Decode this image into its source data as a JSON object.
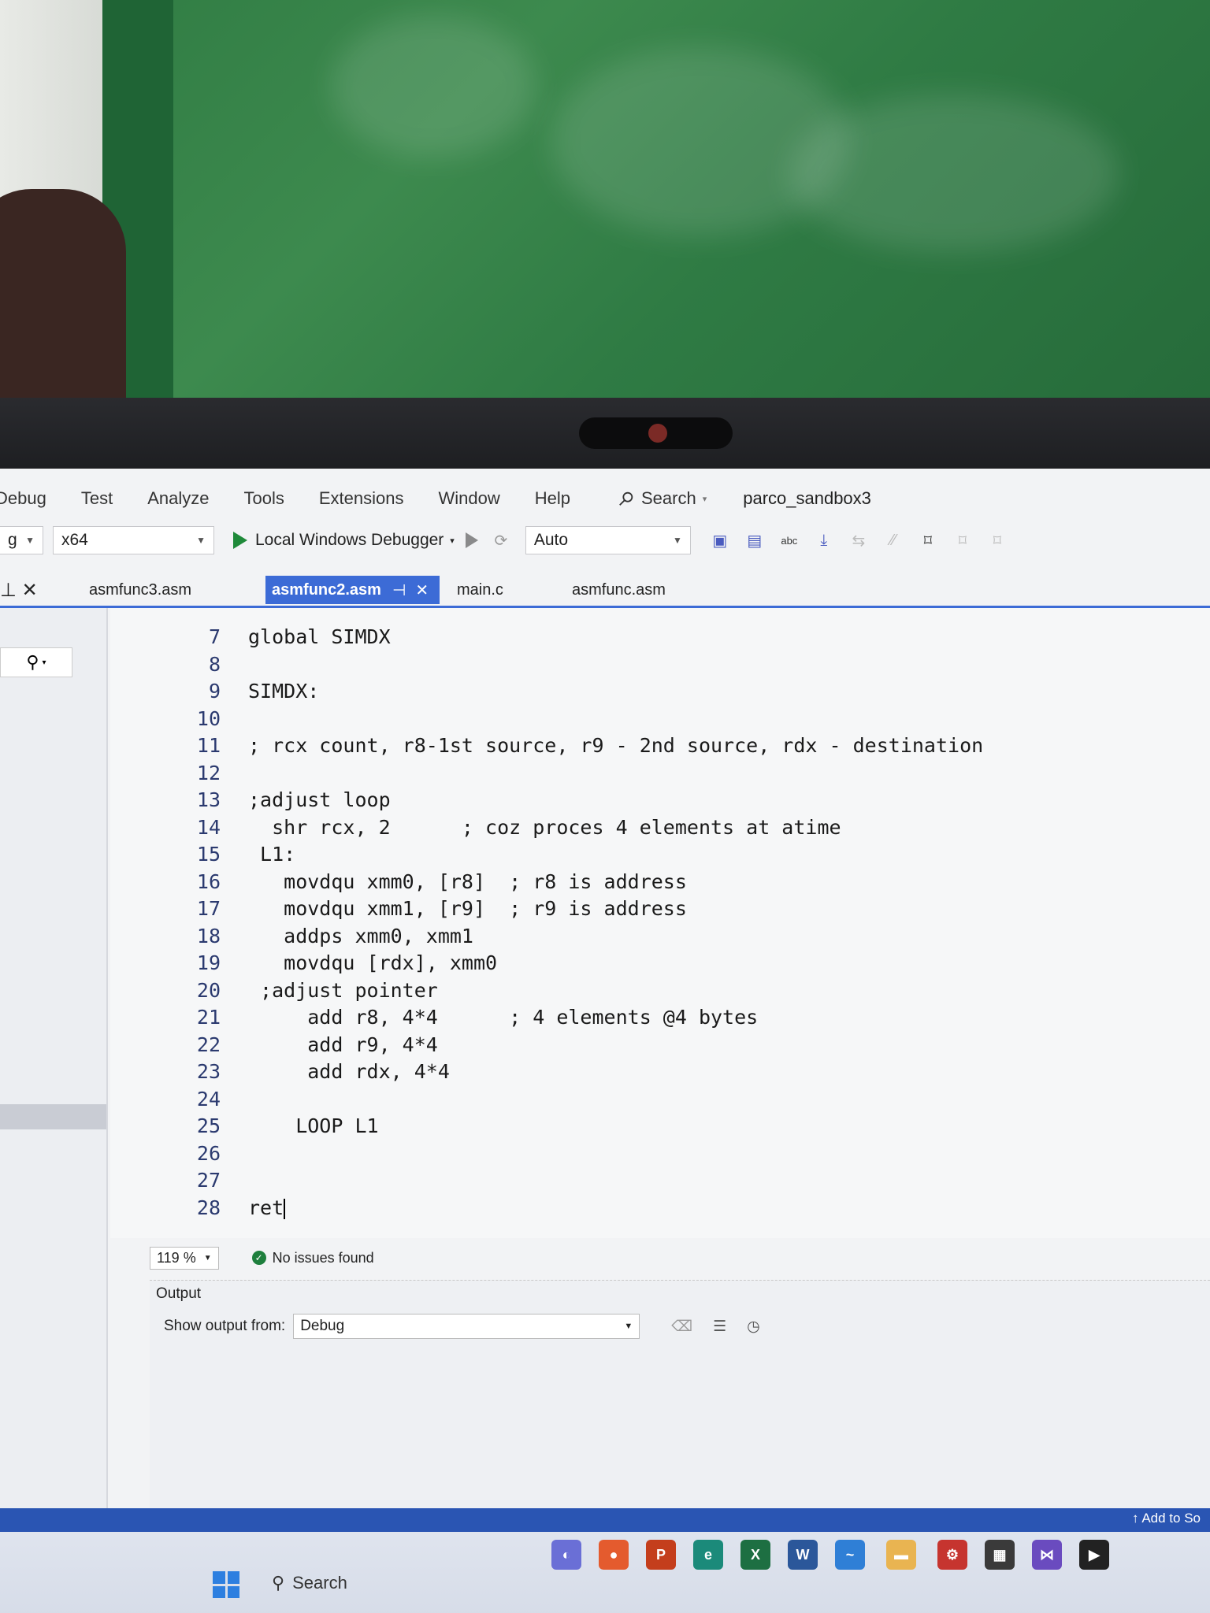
{
  "menubar": {
    "items": [
      "Debug",
      "Test",
      "Analyze",
      "Tools",
      "Extensions",
      "Window",
      "Help"
    ],
    "search_label": "Search",
    "solution_name": "parco_sandbox3"
  },
  "toolbar": {
    "config_value": "g",
    "platform_value": "x64",
    "debugger_label": "Local Windows Debugger",
    "auto_value": "Auto",
    "abc_label": "abc"
  },
  "tabs": {
    "side": "asmfunc3.asm",
    "active": "asmfunc2.asm",
    "tab3": "main.c",
    "tab4": "asmfunc.asm"
  },
  "editor": {
    "line_numbers": [
      "7",
      "8",
      "9",
      "10",
      "11",
      "12",
      "13",
      "14",
      "15",
      "16",
      "17",
      "18",
      "19",
      "20",
      "21",
      "22",
      "23",
      "24",
      "25",
      "26",
      "27",
      "28"
    ],
    "lines": [
      "global SIMDX",
      "",
      "SIMDX:",
      "",
      "; rcx count, r8-1st source, r9 - 2nd source, rdx - destination",
      "",
      ";adjust loop",
      "  shr rcx, 2      ; coz proces 4 elements at atime",
      " L1:",
      "   movdqu xmm0, [r8]  ; r8 is address",
      "   movdqu xmm1, [r9]  ; r9 is address",
      "   addps xmm0, xmm1",
      "   movdqu [rdx], xmm0",
      " ;adjust pointer",
      "     add r8, 4*4      ; 4 elements @4 bytes",
      "     add r9, 4*4",
      "     add rdx, 4*4",
      "",
      "    LOOP L1",
      "",
      "",
      "ret"
    ]
  },
  "status": {
    "zoom": "119 %",
    "issues": "No issues found"
  },
  "output": {
    "title": "Output",
    "show_from_label": "Show output from:",
    "source_value": "Debug"
  },
  "taskbar": {
    "add_to_source": "Add to So",
    "search_label": "Search"
  }
}
